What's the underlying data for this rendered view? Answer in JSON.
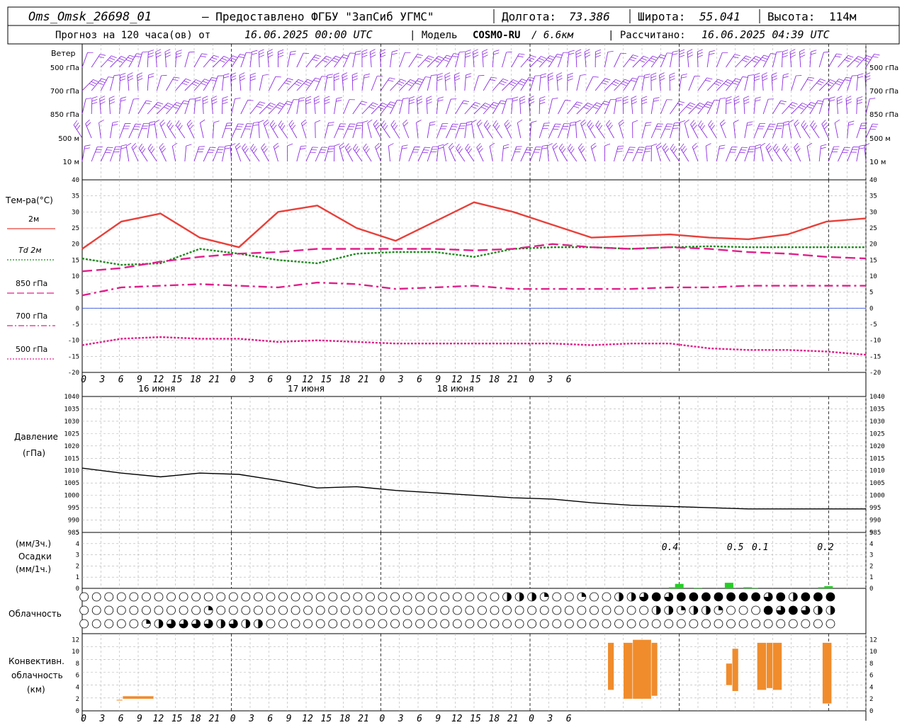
{
  "header": {
    "station": "Oms_Omsk_26698_01",
    "provider": "– Предоставлено ФГБУ \"ЗапСиб УГМС\"",
    "lon_label": "Долгота:",
    "lon_value": "73.386",
    "lat_label": "Широта:",
    "lat_value": "55.041",
    "alt_label": "Высота:",
    "alt_value": "114м",
    "forecast_label": "Прогноз на 120 часа(ов)  от",
    "forecast_start": "16.06.2025 00:00 UTC",
    "model_label": "| Модель",
    "model_name": "COSMO-RU",
    "model_res": "/ 6.6км",
    "calc_label": "| Рассчитано:",
    "calc_time": "16.06.2025 04:39 UTC"
  },
  "wind_panel": {
    "title": "Ветер",
    "levels": [
      "500 гПа",
      "700 гПа",
      "850 гПа",
      "500 м",
      "10  м"
    ],
    "barb_color": "#8c2be2"
  },
  "temp_panel": {
    "ylabel": "Тем-ра(°С)",
    "ylim": [
      -20,
      40
    ],
    "yticks": [
      "40",
      "35",
      "30",
      "25",
      "20",
      "15",
      "10",
      "5",
      "0",
      "-5",
      "-10",
      "-15",
      "-20"
    ]
  },
  "x_axis": {
    "tick_labels": [
      "0",
      "3",
      "6",
      "9",
      "12",
      "15",
      "18",
      "21",
      "0",
      "3",
      "6",
      "9",
      "12",
      "15",
      "18",
      "21",
      "0",
      "3",
      "6",
      "9",
      "12",
      "15",
      "18",
      "21",
      "0",
      "3",
      "6"
    ],
    "day_labels": [
      "16 июня",
      "17 июня",
      "18 июня"
    ]
  },
  "pressure_panel": {
    "ylabel1": "Давление",
    "ylabel2": "(гПа)",
    "ylim": [
      985,
      1040
    ],
    "yticks": [
      "1040",
      "1035",
      "1030",
      "1025",
      "1020",
      "1015",
      "1010",
      "1005",
      "1000",
      "995",
      "990",
      "985"
    ]
  },
  "precip_panel": {
    "ylabel1": "(мм/3ч.)",
    "ylabel2": "Осадки",
    "ylabel3": "(мм/1ч.)",
    "yticks": [
      "5",
      "4",
      "3",
      "2",
      "1",
      "0"
    ],
    "annotations": [
      "0.4",
      "0.5",
      "0.1",
      "0.2"
    ]
  },
  "cloud_panel": {
    "ylabel": "Облачность"
  },
  "conv_panel": {
    "ylabel1": "Конвективн.",
    "ylabel2": "облачность",
    "ylabel3": "(км)",
    "yticks": [
      "12",
      "10",
      "8",
      "6",
      "4",
      "2",
      "0"
    ],
    "color": "#f08c2c"
  },
  "chart_data": {
    "type": "line",
    "x_hours": [
      0,
      6,
      12,
      18,
      24,
      30,
      36,
      42,
      48,
      54,
      60,
      66,
      72,
      78,
      84,
      90,
      96,
      102,
      108,
      114,
      120
    ],
    "series": [
      {
        "name": "2м",
        "color": "#e8403a",
        "style": "solid",
        "values": [
          18.5,
          27,
          29.5,
          22,
          19,
          30,
          32,
          25,
          21,
          27,
          33,
          30,
          26,
          22,
          22.5,
          23,
          22,
          21.5,
          23,
          27,
          28
        ]
      },
      {
        "name": "Td  2м",
        "color": "#1f8a1f",
        "style": "dotted",
        "values": [
          15.5,
          13.5,
          14,
          18.5,
          17,
          15,
          14,
          17,
          17.5,
          17.5,
          16,
          18.5,
          19,
          19,
          18.5,
          19,
          19.3,
          19,
          19,
          19,
          19
        ]
      },
      {
        "name": "850 гПа",
        "color": "#e0208a",
        "style": "longdash",
        "values": [
          11.5,
          12.5,
          14.5,
          16,
          17,
          17.5,
          18.5,
          18.5,
          18.5,
          18.5,
          18,
          18.5,
          20,
          19,
          18.5,
          19,
          18.5,
          17.5,
          17,
          16,
          15.5
        ]
      },
      {
        "name": "700 гПа",
        "color": "#e0208a",
        "style": "dashdot",
        "values": [
          4,
          6.5,
          7,
          7.5,
          7,
          6.5,
          8,
          7.5,
          6,
          6.5,
          7,
          6,
          6,
          6,
          6,
          6.5,
          6.5,
          7,
          7,
          7,
          7
        ]
      },
      {
        "name": "500 гПа",
        "color": "#e0208a",
        "style": "dotted",
        "values": [
          -11.5,
          -9.5,
          -9,
          -9.5,
          -9.5,
          -10.5,
          -10,
          -10.5,
          -11,
          -11,
          -11,
          -11,
          -11,
          -11.5,
          -11,
          -11,
          -12.5,
          -13,
          -13,
          -13.5,
          -14.5
        ]
      }
    ],
    "pressure": {
      "values": [
        1011,
        1009,
        1007.5,
        1009,
        1008.5,
        1006,
        1003,
        1003.5,
        1002,
        1001,
        1000,
        999,
        998.5,
        997,
        996,
        995.5,
        995,
        994.5,
        994.5,
        994.5,
        994.5
      ]
    },
    "precip_hourly": [
      {
        "hour": 95,
        "value": 0.1
      },
      {
        "hour": 96,
        "value": 0.4
      },
      {
        "hour": 99,
        "value": 0.05
      },
      {
        "hour": 104,
        "value": 0.5
      },
      {
        "hour": 107,
        "value": 0.1
      },
      {
        "hour": 108,
        "value": 0.05
      },
      {
        "hour": 119,
        "value": 0.1
      },
      {
        "hour": 120,
        "value": 0.2
      }
    ],
    "convective_cloud": [
      {
        "from": 5.5,
        "to": 6.5,
        "base": 1.7,
        "top": 1.9
      },
      {
        "from": 6.5,
        "to": 11.5,
        "base": 2.0,
        "top": 2.5
      },
      {
        "from": 84.5,
        "to": 85.5,
        "base": 3.5,
        "top": 11.5
      },
      {
        "from": 87,
        "to": 88.5,
        "base": 2.0,
        "top": 11.5
      },
      {
        "from": 88.5,
        "to": 91.5,
        "base": 2.0,
        "top": 12.0
      },
      {
        "from": 91.5,
        "to": 92.5,
        "base": 2.5,
        "top": 11.5
      },
      {
        "from": 103.5,
        "to": 104.5,
        "base": 4.3,
        "top": 8.0
      },
      {
        "from": 104.5,
        "to": 105.5,
        "base": 3.3,
        "top": 10.5
      },
      {
        "from": 108.5,
        "to": 110,
        "base": 3.5,
        "top": 11.5
      },
      {
        "from": 110,
        "to": 111,
        "base": 3.8,
        "top": 11.5
      },
      {
        "from": 111,
        "to": 112.5,
        "base": 3.5,
        "top": 11.5
      },
      {
        "from": 119,
        "to": 120.5,
        "base": 1.2,
        "top": 11.5
      }
    ],
    "cloud_cover": {
      "note": "three rows of circles per hour (0..120 step 2); fraction filled 0..1",
      "high": [
        0,
        0,
        0,
        0,
        0,
        0,
        0,
        0,
        0,
        0,
        0,
        0,
        0,
        0,
        0,
        0,
        0,
        0,
        0,
        0,
        0,
        0,
        0,
        0,
        0,
        0,
        0,
        0,
        0,
        0,
        0,
        0,
        0,
        0,
        0.5,
        0.5,
        0.5,
        0.25,
        0,
        0,
        0.25,
        0,
        0,
        0.5,
        0.5,
        0.75,
        1,
        0.75,
        1,
        1,
        1,
        1,
        1,
        1,
        1,
        0.75,
        1,
        0.5,
        1,
        1,
        1
      ],
      "mid": [
        0,
        0,
        0,
        0,
        0,
        0,
        0,
        0,
        0,
        0,
        0.25,
        0,
        0,
        0,
        0,
        0,
        0,
        0,
        0,
        0,
        0,
        0,
        0,
        0,
        0,
        0,
        0,
        0,
        0,
        0,
        0,
        0,
        0,
        0,
        0,
        0,
        0,
        0,
        0,
        0,
        0,
        0,
        0,
        0,
        0,
        0,
        0.5,
        0.5,
        0.25,
        0.5,
        0.5,
        0.25,
        0,
        0,
        0,
        1,
        0.75,
        1,
        0.75,
        0.5,
        0.5
      ],
      "low": [
        0,
        0,
        0,
        0,
        0,
        0.25,
        0.5,
        0.75,
        0.75,
        0.75,
        0.75,
        0.5,
        0.75,
        0.5,
        0.5,
        0,
        0,
        0,
        0,
        0,
        0,
        0,
        0,
        0,
        0,
        0,
        0,
        0,
        0,
        0,
        0,
        0,
        0,
        0,
        0,
        0,
        0,
        0,
        0,
        0,
        0,
        0,
        0,
        0,
        0,
        0,
        0,
        0,
        0,
        0,
        0,
        0,
        0,
        0,
        0,
        0,
        0,
        0,
        0,
        0,
        0
      ]
    }
  }
}
